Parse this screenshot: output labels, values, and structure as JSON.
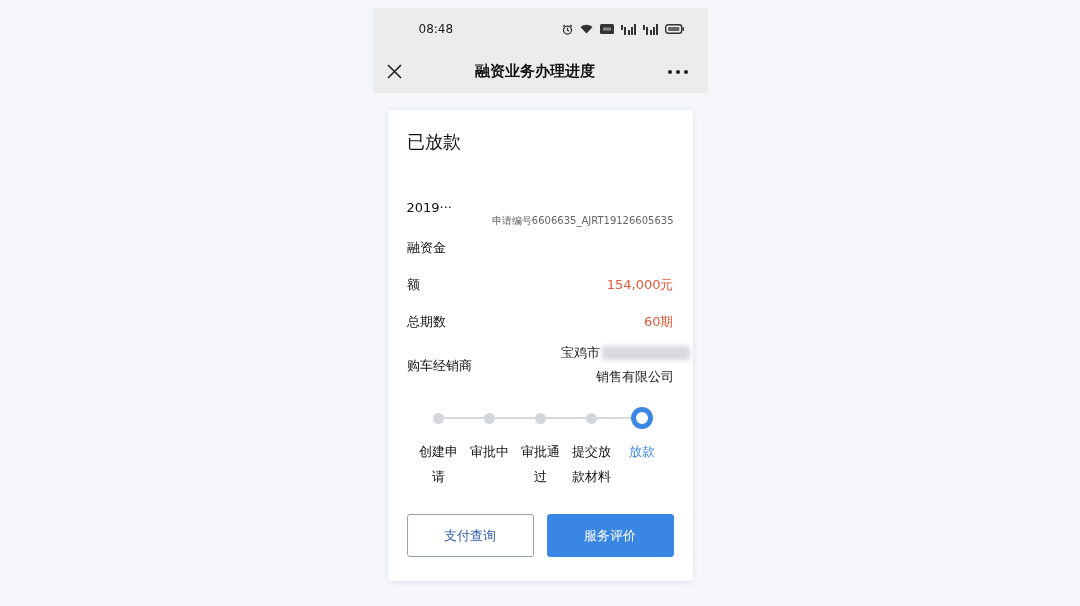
{
  "status_bar": {
    "time": "08:48"
  },
  "nav_bar": {
    "title": "融资业务办理进度"
  },
  "card": {
    "status": "已放款",
    "rows": [
      {
        "kind": "id",
        "label": "2019···",
        "value": "申请编号6606635_AJRT19126605635",
        "highlight": false
      },
      {
        "kind": "value",
        "label": "融资金额",
        "value": "154,000元",
        "highlight": true
      },
      {
        "kind": "value",
        "label": "总期数",
        "value": "60期",
        "highlight": true
      },
      {
        "kind": "address",
        "label": "购车经销商",
        "value_lines": [
          "宝鸡市",
          "销售有限公司"
        ],
        "redacted": true,
        "highlight": false
      }
    ],
    "steps": [
      {
        "label": "创建申请",
        "current": false
      },
      {
        "label": "审批中",
        "current": false
      },
      {
        "label": "审批通过",
        "current": false
      },
      {
        "label": "提交放款材料",
        "current": false
      },
      {
        "label": "放款",
        "current": true
      }
    ],
    "buttons": [
      {
        "label": "支付查询",
        "primary": false
      },
      {
        "label": "服务评价",
        "primary": true
      }
    ]
  }
}
